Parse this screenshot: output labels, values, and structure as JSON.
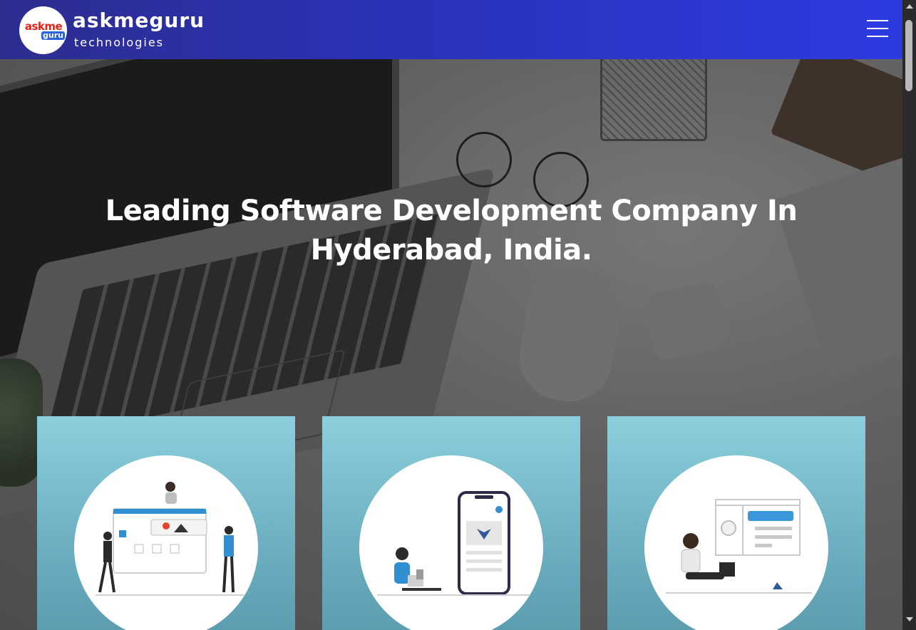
{
  "header": {
    "logo": {
      "word_top": "askme",
      "word_badge": "guru"
    },
    "brand_name": "askmeguru",
    "brand_subtitle": "technologies",
    "menu_icon": "hamburger-menu-icon"
  },
  "hero": {
    "title": "Leading Software Development Company In Hyderabad, India."
  },
  "cards": [
    {
      "illustration": "web-design-team-illustration"
    },
    {
      "illustration": "mobile-app-illustration"
    },
    {
      "illustration": "dashboard-user-illustration"
    }
  ],
  "colors": {
    "header_gradient_start": "#2c2d8f",
    "header_gradient_end": "#2c3be0",
    "card_top": "#8ccfdc",
    "card_bottom": "#5c9db0",
    "logo_red": "#e2231a",
    "logo_blue": "#2b63d9"
  }
}
